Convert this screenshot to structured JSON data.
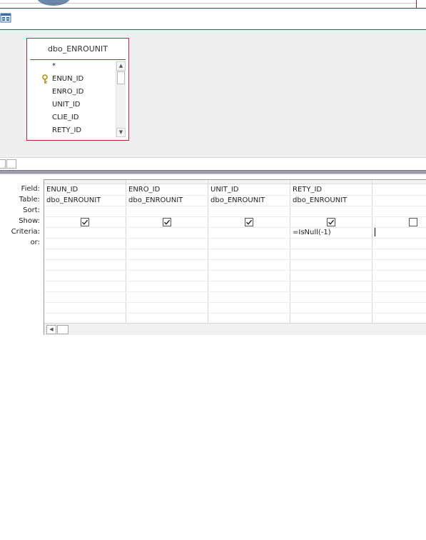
{
  "design_view": {
    "table": {
      "title": "dbo_ENROUNIT",
      "fields": [
        {
          "name": "*",
          "is_key": false
        },
        {
          "name": "ENUN_ID",
          "is_key": true
        },
        {
          "name": "ENRO_ID",
          "is_key": false
        },
        {
          "name": "UNIT_ID",
          "is_key": false
        },
        {
          "name": "CLIE_ID",
          "is_key": false
        },
        {
          "name": "RETY_ID",
          "is_key": false
        }
      ],
      "scroll_up_icon": "triangle-up",
      "scroll_down_icon": "triangle-down"
    }
  },
  "grid": {
    "row_labels": {
      "field": "Field:",
      "table": "Table:",
      "sort": "Sort:",
      "show": "Show:",
      "criteria": "Criteria:",
      "or": "or:"
    },
    "columns": [
      {
        "field": "ENUN_ID",
        "table": "dbo_ENROUNIT",
        "sort": "",
        "show": true,
        "criteria": "",
        "or": ""
      },
      {
        "field": "ENRO_ID",
        "table": "dbo_ENROUNIT",
        "sort": "",
        "show": true,
        "criteria": "",
        "or": ""
      },
      {
        "field": "UNIT_ID",
        "table": "dbo_ENROUNIT",
        "sort": "",
        "show": true,
        "criteria": "",
        "or": ""
      },
      {
        "field": "RETY_ID",
        "table": "dbo_ENROUNIT",
        "sort": "",
        "show": true,
        "criteria": "=IsNull(-1)",
        "or": ""
      },
      {
        "field": "",
        "table": "",
        "sort": "",
        "show": false,
        "criteria": "",
        "or": ""
      }
    ],
    "scroll_left_icon": "triangle-left"
  },
  "colors": {
    "accent_red": "#c0263b",
    "pane_bg": "#eeeff1",
    "splitter": "#9a9aaa"
  }
}
